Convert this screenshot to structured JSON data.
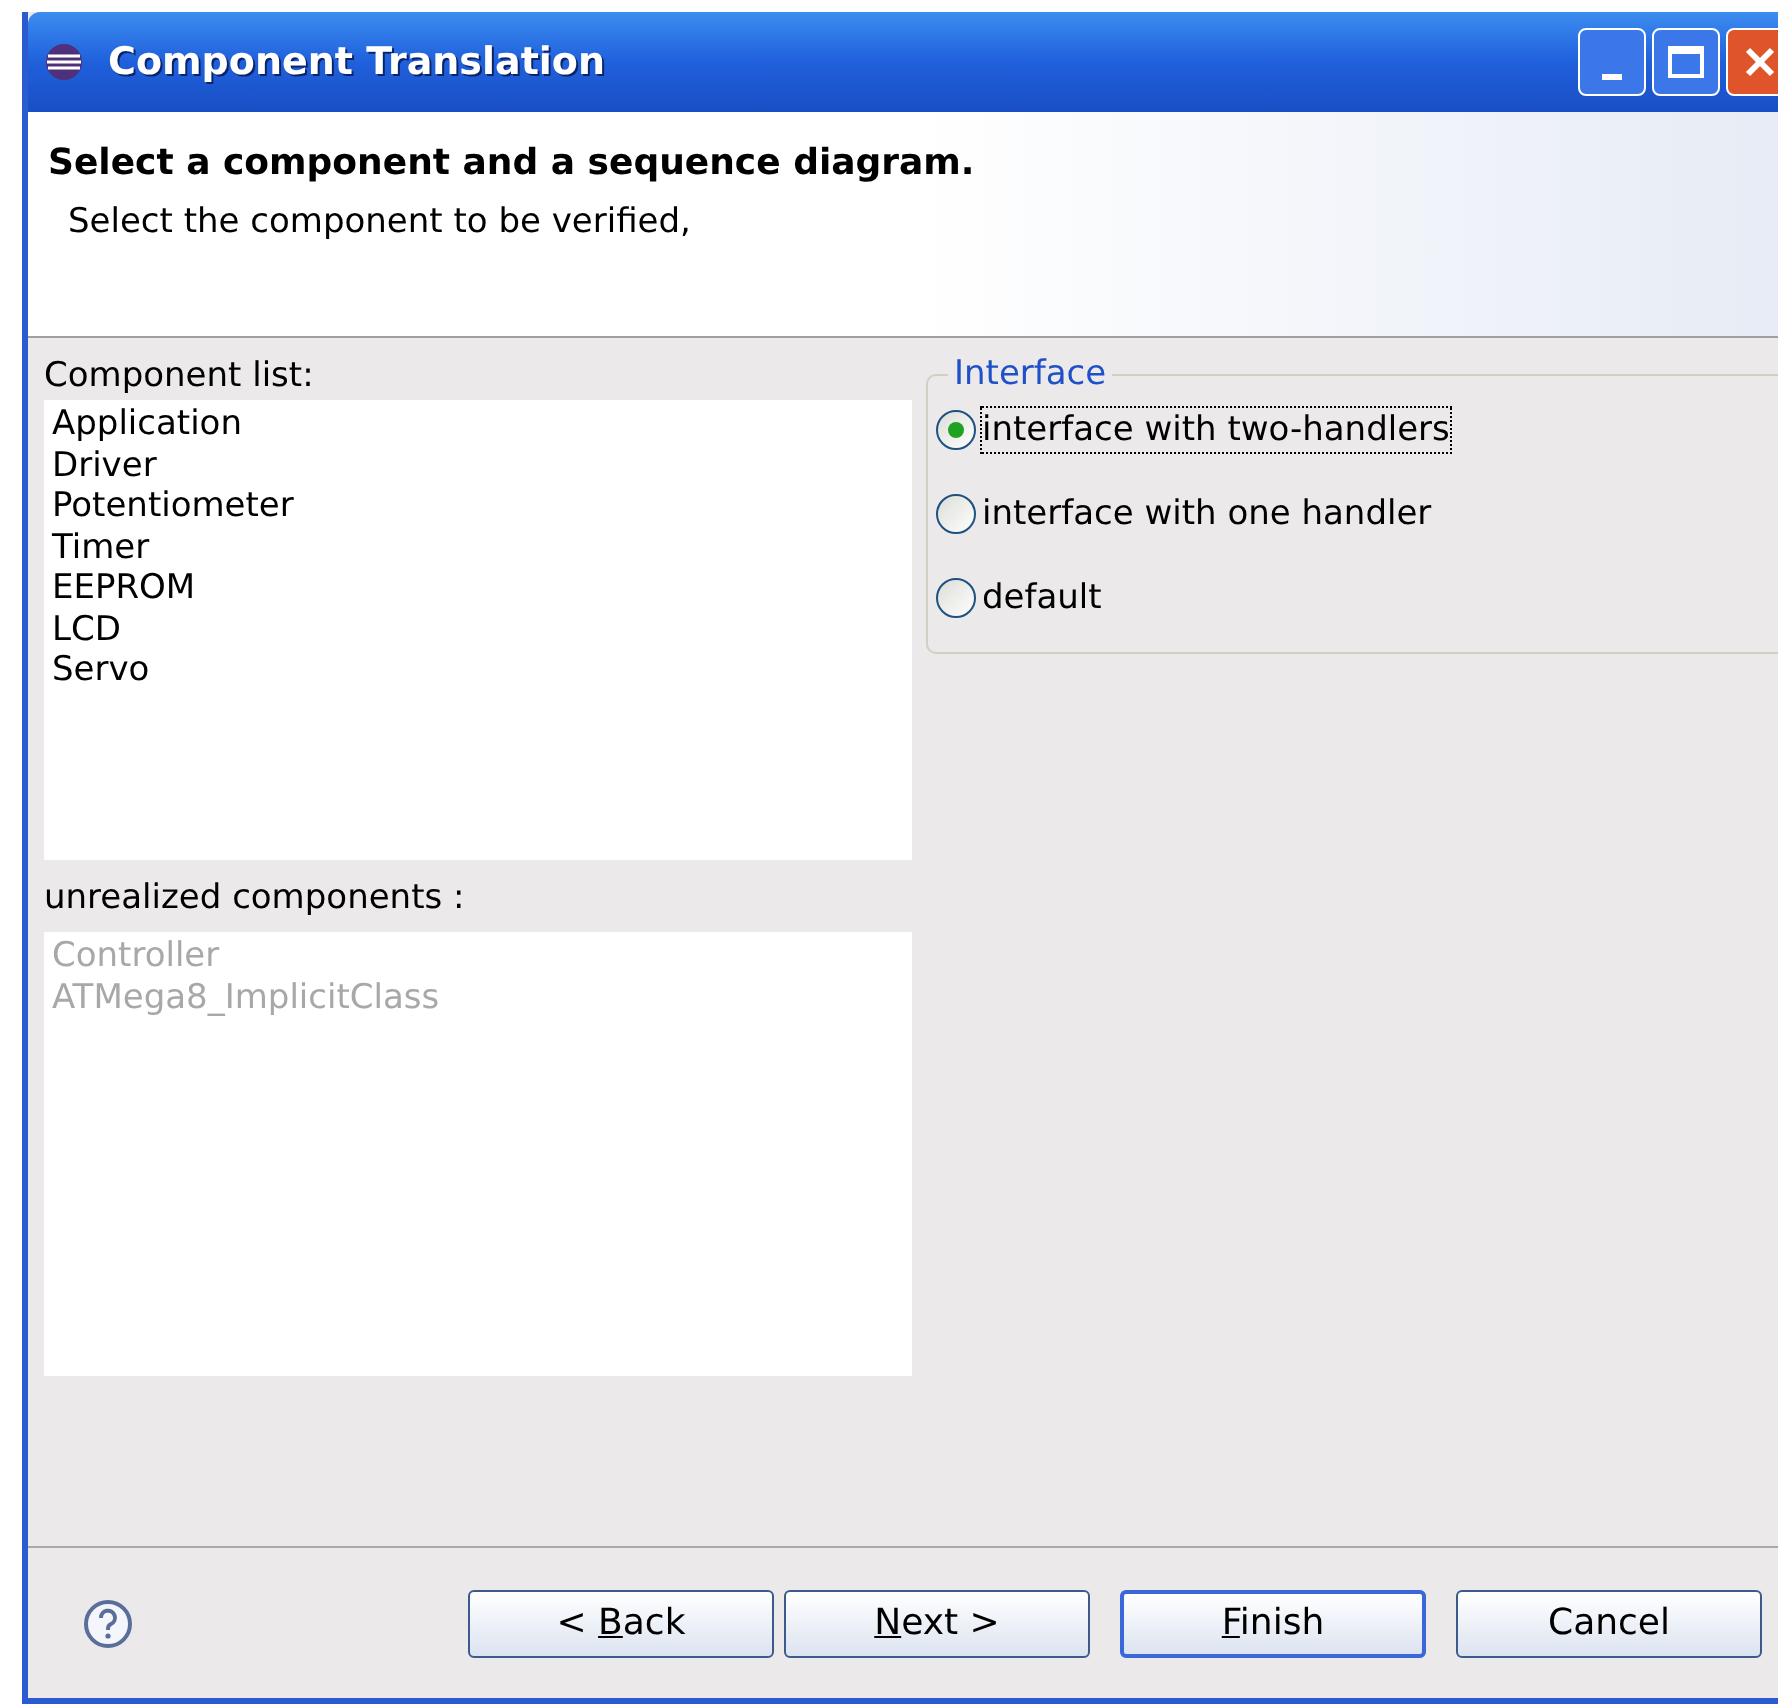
{
  "window": {
    "title": "Component Translation"
  },
  "header": {
    "title": "Select a component and a sequence diagram.",
    "description": "Select the component to be verified,"
  },
  "component_list": {
    "label": "Component list:",
    "items": [
      "Application",
      "Driver",
      "Potentiometer",
      "Timer",
      "EEPROM",
      "LCD",
      "Servo"
    ]
  },
  "unrealized_components": {
    "label": "unrealized components :",
    "items": [
      "Controller",
      "ATMega8_ImplicitClass"
    ]
  },
  "interface": {
    "title": "Interface",
    "options": [
      {
        "label": "interface with two-handlers",
        "selected": true
      },
      {
        "label": "interface with one handler",
        "selected": false
      },
      {
        "label": "default",
        "selected": false
      }
    ]
  },
  "buttons": [
    {
      "before": "< ",
      "key": "B",
      "after": "ack",
      "default": false
    },
    {
      "key": "N",
      "after": "ext >",
      "default": false
    },
    {
      "key": "F",
      "after": "inish",
      "default": true
    },
    {
      "before": "Cancel",
      "default": false
    }
  ]
}
